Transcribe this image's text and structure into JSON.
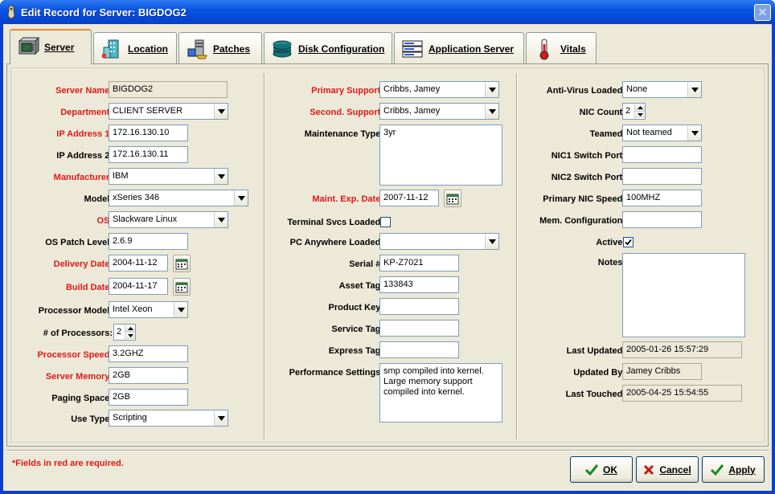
{
  "window": {
    "title": "Edit Record for Server: BIGDOG2",
    "close_glyph": "✕"
  },
  "tabs": [
    {
      "label": "Server",
      "icon": "server-icon"
    },
    {
      "label": "Location",
      "icon": "building-icon"
    },
    {
      "label": "Patches",
      "icon": "patches-icon"
    },
    {
      "label": "Disk Configuration",
      "icon": "disk-icon"
    },
    {
      "label": "Application Server",
      "icon": "app-server-icon"
    },
    {
      "label": "Vitals",
      "icon": "thermometer-icon"
    }
  ],
  "col1": {
    "server_name": {
      "label": "Server Name:",
      "value": "BIGDOG2"
    },
    "department": {
      "label": "Department:",
      "value": "CLIENT SERVER"
    },
    "ip1": {
      "label": "IP Address 1:",
      "value": "172.16.130.10"
    },
    "ip2": {
      "label": "IP Address 2:",
      "value": "172.16.130.11"
    },
    "manufacturer": {
      "label": "Manufacturer:",
      "value": "IBM"
    },
    "model": {
      "label": "Model:",
      "value": "xSeries 346"
    },
    "os": {
      "label": "OS:",
      "value": "Slackware Linux"
    },
    "os_patch": {
      "label": "OS Patch Level:",
      "value": "2.6.9"
    },
    "delivery_date": {
      "label": "Delivery Date:",
      "value": "2004-11-12"
    },
    "build_date": {
      "label": "Build Date:",
      "value": "2004-11-17"
    },
    "processor_model": {
      "label": "Processor Model:",
      "value": "Intel Xeon"
    },
    "num_processors": {
      "label": "# of Processors:",
      "value": "2"
    },
    "processor_speed": {
      "label": "Processor Speed:",
      "value": "3.2GHZ"
    },
    "server_memory": {
      "label": "Server Memory:",
      "value": "2GB"
    },
    "paging_space": {
      "label": "Paging Space:",
      "value": "2GB"
    },
    "use_type": {
      "label": "Use Type:",
      "value": "Scripting"
    }
  },
  "col2": {
    "primary_support": {
      "label": "Primary Support:",
      "value": "Cribbs, Jamey"
    },
    "second_support": {
      "label": "Second. Support:",
      "value": "Cribbs, Jamey"
    },
    "maintenance_type": {
      "label": "Maintenance Type:",
      "value": "3yr"
    },
    "maint_exp_date": {
      "label": "Maint. Exp. Date:",
      "value": "2007-11-12"
    },
    "terminal_svcs": {
      "label": "Terminal Svcs Loaded:",
      "checked": false
    },
    "pc_anywhere": {
      "label": "PC Anywhere Loaded:",
      "value": ""
    },
    "serial": {
      "label": "Serial #:",
      "value": "KP-Z7021"
    },
    "asset_tag": {
      "label": "Asset Tag:",
      "value": "133843"
    },
    "product_key": {
      "label": "Product Key:",
      "value": ""
    },
    "service_tag": {
      "label": "Service Tag:",
      "value": ""
    },
    "express_tag": {
      "label": "Express Tag:",
      "value": ""
    },
    "performance": {
      "label": "Performance Settings:",
      "value": "smp compiled into kernel.\nLarge memory support\ncompiled into kernel."
    }
  },
  "col3": {
    "antivirus": {
      "label": "Anti-Virus Loaded:",
      "value": "None"
    },
    "nic_count": {
      "label": "NIC Count:",
      "value": "2"
    },
    "teamed": {
      "label": "Teamed:",
      "value": "Not teamed"
    },
    "nic1_port": {
      "label": "NIC1 Switch Port:",
      "value": ""
    },
    "nic2_port": {
      "label": "NIC2 Switch Port:",
      "value": ""
    },
    "nic_speed": {
      "label": "Primary NIC Speed:",
      "value": "100MHZ"
    },
    "mem_config": {
      "label": "Mem. Configuration:",
      "value": ""
    },
    "active": {
      "label": "Active:",
      "checked": true
    },
    "notes": {
      "label": "Notes:",
      "value": ""
    },
    "last_updated": {
      "label": "Last Updated:",
      "value": "2005-01-26 15:57:29"
    },
    "updated_by": {
      "label": "Updated By:",
      "value": "Jamey Cribbs"
    },
    "last_touched": {
      "label": "Last Touched:",
      "value": "2005-04-25 15:54:55"
    }
  },
  "footer": {
    "required_note": "*Fields in red are required.",
    "ok": "OK",
    "cancel": "Cancel",
    "apply": "Apply"
  }
}
